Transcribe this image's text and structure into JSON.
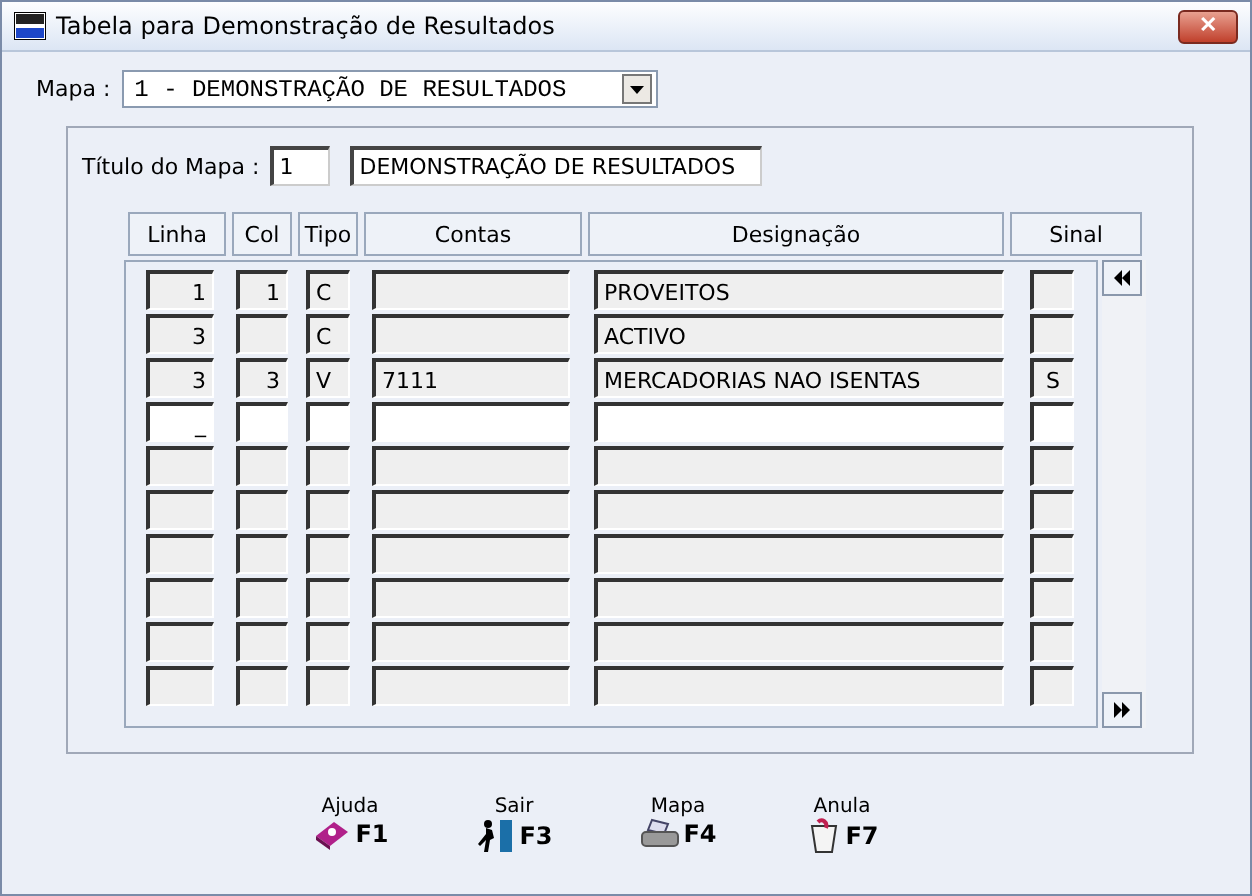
{
  "window": {
    "title": "Tabela para Demonstração de Resultados",
    "close": "✕"
  },
  "mapa": {
    "label": "Mapa :",
    "value": "1 - DEMONSTRAÇÃO DE RESULTADOS"
  },
  "titulo": {
    "label": "Título do Mapa :",
    "number": "1",
    "name": "DEMONSTRAÇÃO DE RESULTADOS"
  },
  "table": {
    "columns": [
      "Linha",
      "Col",
      "Tipo",
      "Contas",
      "Designação",
      "Sinal"
    ],
    "rows": [
      {
        "current": false,
        "cells": [
          "1",
          "1",
          "C",
          "",
          "PROVEITOS",
          ""
        ]
      },
      {
        "current": false,
        "cells": [
          "3",
          "",
          "C",
          "",
          "ACTIVO",
          ""
        ]
      },
      {
        "current": false,
        "cells": [
          "3",
          "3",
          "V",
          "7111",
          "MERCADORIAS NAO ISENTAS",
          "S"
        ]
      },
      {
        "current": true,
        "cells": [
          "_",
          "",
          "",
          "",
          "",
          ""
        ]
      },
      {
        "current": false,
        "cells": [
          "",
          "",
          "",
          "",
          "",
          ""
        ]
      },
      {
        "current": false,
        "cells": [
          "",
          "",
          "",
          "",
          "",
          ""
        ]
      },
      {
        "current": false,
        "cells": [
          "",
          "",
          "",
          "",
          "",
          ""
        ]
      },
      {
        "current": false,
        "cells": [
          "",
          "",
          "",
          "",
          "",
          ""
        ]
      },
      {
        "current": false,
        "cells": [
          "",
          "",
          "",
          "",
          "",
          ""
        ]
      },
      {
        "current": false,
        "cells": [
          "",
          "",
          "",
          "",
          "",
          ""
        ]
      }
    ]
  },
  "buttons": [
    {
      "label": "Ajuda",
      "key": "F1",
      "kind": "help"
    },
    {
      "label": "Sair",
      "key": "F3",
      "kind": "exit"
    },
    {
      "label": "Mapa",
      "key": "F4",
      "kind": "print"
    },
    {
      "label": "Anula",
      "key": "F7",
      "kind": "delete"
    }
  ]
}
